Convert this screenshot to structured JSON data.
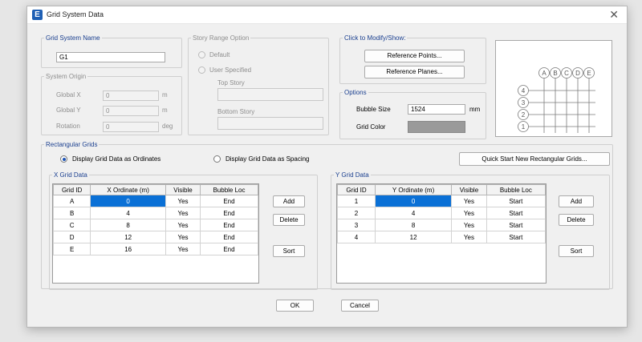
{
  "title": "Grid System Data",
  "gridSystemName": {
    "legend": "Grid System Name",
    "value": "G1"
  },
  "systemOrigin": {
    "legend": "System Origin",
    "globalX": {
      "label": "Global  X",
      "value": "0",
      "unit": "m"
    },
    "globalY": {
      "label": "Global  Y",
      "value": "0",
      "unit": "m"
    },
    "rotation": {
      "label": "Rotation",
      "value": "0",
      "unit": "deg"
    }
  },
  "storyRange": {
    "legend": "Story Range Option",
    "default": "Default",
    "userSpecified": "User Specified",
    "topStory": "Top Story",
    "bottomStory": "Bottom Story"
  },
  "clickToModify": {
    "legend": "Click to Modify/Show:",
    "refPoints": "Reference Points...",
    "refPlanes": "Reference Planes..."
  },
  "options": {
    "legend": "Options",
    "bubbleSizeLabel": "Bubble Size",
    "bubbleSize": "1524",
    "bubbleUnit": "mm",
    "gridColorLabel": "Grid Color",
    "gridColor": "#9a9a9a"
  },
  "preview": {
    "xBubbles": [
      "A",
      "B",
      "C",
      "D",
      "E"
    ],
    "yBubbles": [
      "4",
      "3",
      "2",
      "1"
    ]
  },
  "rectGrids": {
    "legend": "Rectangular Grids",
    "ordinates": "Display Grid Data as Ordinates",
    "spacing": "Display Grid Data as Spacing",
    "quickStart": "Quick Start New Rectangular Grids..."
  },
  "xGrid": {
    "legend": "X Grid Data",
    "headers": [
      "Grid ID",
      "X Ordinate (m)",
      "Visible",
      "Bubble Loc"
    ],
    "rows": [
      [
        "A",
        "0",
        "Yes",
        "End"
      ],
      [
        "B",
        "4",
        "Yes",
        "End"
      ],
      [
        "C",
        "8",
        "Yes",
        "End"
      ],
      [
        "D",
        "12",
        "Yes",
        "End"
      ],
      [
        "E",
        "16",
        "Yes",
        "End"
      ]
    ]
  },
  "yGrid": {
    "legend": "Y Grid Data",
    "headers": [
      "Grid ID",
      "Y Ordinate (m)",
      "Visible",
      "Bubble Loc"
    ],
    "rows": [
      [
        "1",
        "0",
        "Yes",
        "Start"
      ],
      [
        "2",
        "4",
        "Yes",
        "Start"
      ],
      [
        "3",
        "8",
        "Yes",
        "Start"
      ],
      [
        "4",
        "12",
        "Yes",
        "Start"
      ]
    ]
  },
  "buttons": {
    "add": "Add",
    "delete": "Delete",
    "sort": "Sort",
    "ok": "OK",
    "cancel": "Cancel"
  },
  "accentColor": "#0a70d6"
}
